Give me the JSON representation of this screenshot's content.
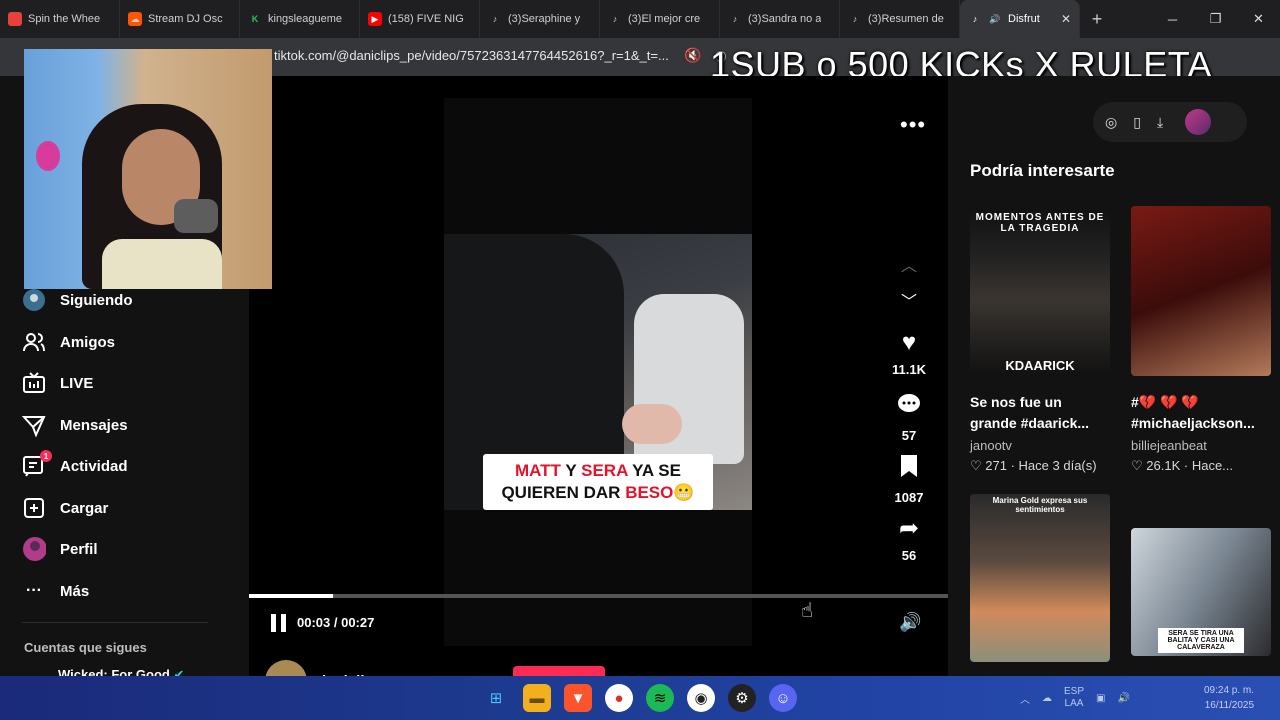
{
  "browser": {
    "tabs": [
      {
        "label": "Spin the Whee",
        "icon": "wheel-icon",
        "color": "#e8413c"
      },
      {
        "label": "Stream DJ Osc",
        "icon": "soundcloud-icon",
        "color": "#ff5500"
      },
      {
        "label": "kingsleagueme",
        "icon": "kings-league-icon",
        "color": "#22c55e"
      },
      {
        "label": "(158) FIVE NIG",
        "icon": "youtube-icon",
        "color": "#ff0000"
      },
      {
        "label": "(3)Seraphine y",
        "icon": "tiktok-icon",
        "color": "#ffffff"
      },
      {
        "label": "(3)El mejor cre",
        "icon": "tiktok-icon",
        "color": "#ffffff"
      },
      {
        "label": "(3)Sandra no a",
        "icon": "tiktok-icon",
        "color": "#ffffff"
      },
      {
        "label": "(3)Resumen de",
        "icon": "tiktok-icon",
        "color": "#ffffff"
      },
      {
        "label": "Disfrut",
        "icon": "tiktok-icon",
        "color": "#ffffff",
        "active": true
      }
    ],
    "url": "tiktok.com/@daniclips_pe/video/7572363147764452616?_r=1&_t=...",
    "overlay_text": "1SUB o 500 KICKs X RULETA"
  },
  "sidebar": {
    "items": [
      {
        "label": "Siguiendo",
        "icon": "following-avatar-icon"
      },
      {
        "label": "Amigos",
        "icon": "friends-icon"
      },
      {
        "label": "LIVE",
        "icon": "live-icon"
      },
      {
        "label": "Mensajes",
        "icon": "messages-icon"
      },
      {
        "label": "Actividad",
        "icon": "activity-icon",
        "badge": "1"
      },
      {
        "label": "Cargar",
        "icon": "upload-icon"
      },
      {
        "label": "Perfil",
        "icon": "profile-avatar-icon"
      },
      {
        "label": "Más",
        "icon": "more-icon"
      }
    ],
    "following_heading": "Cuentas que sigues",
    "following_first": "Wicked: For Good"
  },
  "video": {
    "caption_parts": [
      "MATT",
      " Y ",
      "SERA",
      " YA SE",
      "QUIEREN DAR ",
      "BESO",
      "😬"
    ],
    "likes": "11.1K",
    "comments": "57",
    "saves": "1087",
    "shares": "56",
    "time": "00:03 / 00:27",
    "progress": 0.12,
    "author": "daniclips_pe"
  },
  "recommendations": {
    "title": "Podría interesarte",
    "cards": [
      {
        "title": "Se nos fue un grande #daarick...",
        "user": "janootv",
        "likes": "271",
        "when": "Hace 3 día(s)",
        "thumb_top_text": "MOMENTOS ANTES DE LA TRAGEDIA",
        "thumb_bottom_text": "KDAARICK"
      },
      {
        "title": "#💔 💔 💔 #michaeljackson...",
        "user": "billiejeanbeat",
        "likes": "26.1K",
        "when": "Hace...",
        "thumb_top_text": "",
        "thumb_bottom_text": ""
      },
      {
        "title": "",
        "user": "",
        "likes": "",
        "when": "",
        "thumb_top_text": "Marina Gold expresa sus sentimientos",
        "thumb_bottom_text": ""
      },
      {
        "title": "",
        "user": "",
        "likes": "",
        "when": "",
        "thumb_top_text": "",
        "thumb_bottom_text": "SERA SE TIRA UNA BALITA Y CASI UNA CALAVERAZA"
      }
    ]
  },
  "taskbar": {
    "lang": "ESP",
    "lang2": "LAA",
    "time": "09:24 p. m.",
    "date": "16/11/2025"
  }
}
